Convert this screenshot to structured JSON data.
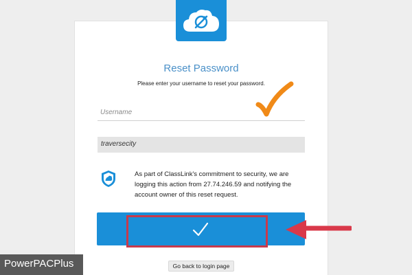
{
  "header": {
    "logo_icon": "classlink-cloud-logo",
    "accent_color": "#1a8fd8"
  },
  "form": {
    "title": "Reset Password",
    "subtitle": "Please enter your username to reset your password.",
    "username_placeholder": "Username",
    "entered_value": "traversecity",
    "security_icon": "shield-logo-icon",
    "security_notice": "As part of ClassLink's commitment to security, we are logging this action from 27.74.246.59 and notifying the account owner of this reset request.",
    "submit_icon": "checkmark-icon",
    "back_link_label": "Go back to login page"
  },
  "annotations": {
    "orange_check_icon": "orange-checkmark-icon",
    "arrow_icon": "red-arrow-icon",
    "highlight_color": "#c83a4b"
  },
  "watermark": {
    "label": "PowerPACPlus"
  }
}
